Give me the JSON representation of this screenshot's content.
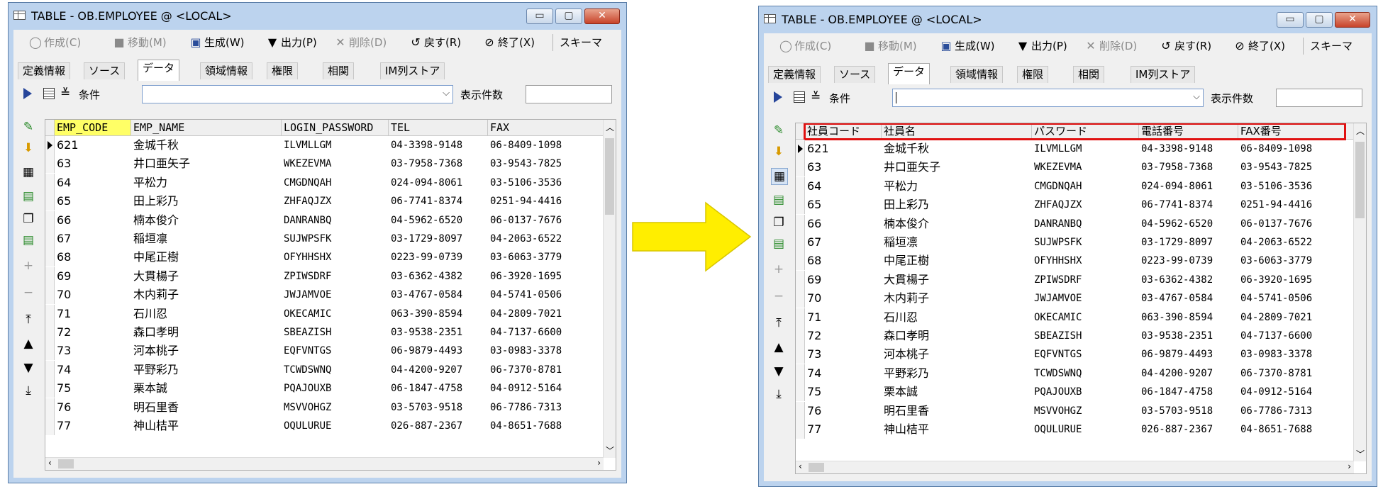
{
  "window": {
    "title": "TABLE - OB.EMPLOYEE @ <LOCAL>",
    "controls": {
      "minimize": "▭",
      "maximize": "▢",
      "close": "✕"
    }
  },
  "toolbar": {
    "create": "作成(C)",
    "move": "移動(M)",
    "generate": "生成(W)",
    "output": "出力(P)",
    "delete": "削除(D)",
    "revert": "戻す(R)",
    "finish": "終了(X)",
    "schema": "スキーマ"
  },
  "tabs": [
    "定義情報",
    "ソース",
    "データ",
    "領域情報",
    "権限",
    "相関",
    "IM列ストア"
  ],
  "condition": {
    "label": "条件",
    "count_label": "表示件数",
    "value": "",
    "count_value": ""
  },
  "columns_before": [
    "EMP_CODE",
    "EMP_NAME",
    "LOGIN_PASSWORD",
    "TEL",
    "FAX"
  ],
  "columns_after": [
    "社員コード",
    "社員名",
    "パスワード",
    "電話番号",
    "FAX番号"
  ],
  "rows": [
    [
      "621",
      "金城千秋",
      "ILVMLLGM",
      "04-3398-9148",
      "06-8409-1098"
    ],
    [
      "63",
      "井口亜矢子",
      "WKEZEVMA",
      "03-7958-7368",
      "03-9543-7825"
    ],
    [
      "64",
      "平松力",
      "CMGDNQAH",
      "024-094-8061",
      "03-5106-3536"
    ],
    [
      "65",
      "田上彩乃",
      "ZHFAQJZX",
      "06-7741-8374",
      "0251-94-4416"
    ],
    [
      "66",
      "楠本俊介",
      "DANRANBQ",
      "04-5962-6520",
      "06-0137-7676"
    ],
    [
      "67",
      "稲垣凛",
      "SUJWPSFK",
      "03-1729-8097",
      "04-2063-6522"
    ],
    [
      "68",
      "中尾正樹",
      "OFYHHSHX",
      "0223-99-0739",
      "03-6063-3779"
    ],
    [
      "69",
      "大貫楊子",
      "ZPIWSDRF",
      "03-6362-4382",
      "06-3920-1695"
    ],
    [
      "70",
      "木内莉子",
      "JWJAMVOE",
      "03-4767-0584",
      "04-5741-0506"
    ],
    [
      "71",
      "石川忍",
      "OKECAMIC",
      "063-390-8594",
      "04-2809-7021"
    ],
    [
      "72",
      "森口孝明",
      "SBEAZISH",
      "03-9538-2351",
      "04-7137-6600"
    ],
    [
      "73",
      "河本桃子",
      "EQFVNTGS",
      "06-9879-4493",
      "03-0983-3378"
    ],
    [
      "74",
      "平野彩乃",
      "TCWDSWNQ",
      "04-4200-9207",
      "06-7370-8781"
    ],
    [
      "75",
      "栗本誠",
      "PQAJOUXB",
      "06-1847-4758",
      "04-0912-5164"
    ],
    [
      "76",
      "明石里香",
      "MSVVOHGZ",
      "03-5703-9518",
      "06-7786-7313"
    ],
    [
      "77",
      "神山桔平",
      "OQULURUE",
      "026-887-2367",
      "04-8651-7688"
    ]
  ],
  "colors": {
    "highlight": "#e01010",
    "arrow": "#ffee00",
    "header_highlight": "#ffff66"
  }
}
